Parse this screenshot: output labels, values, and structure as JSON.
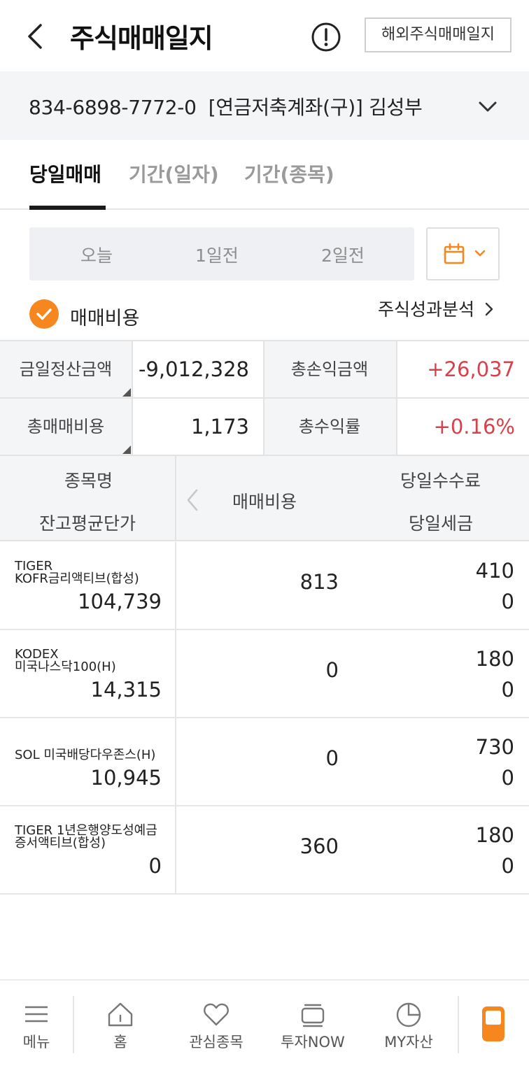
{
  "header": {
    "title": "주식매매일지",
    "foreign_button": "해외주식매매일지"
  },
  "account": {
    "text": "834-6898-7772-0  [연금저축계좌(구)] 김성부"
  },
  "tabs": [
    {
      "label": "당일매매",
      "active": true
    },
    {
      "label": "기간(일자)",
      "active": false
    },
    {
      "label": "기간(종목)",
      "active": false
    }
  ],
  "days": [
    "오늘",
    "1일전",
    "2일전"
  ],
  "options": {
    "fee_checkbox_label": "매매비용",
    "fee_checked": true,
    "analysis_link": "주식성과분석"
  },
  "summary": {
    "settle_label": "금일정산금액",
    "settle_value": "-9,012,328",
    "total_pl_label": "총손익금액",
    "total_pl_value": "+26,037",
    "total_cost_label": "총매매비용",
    "total_cost_value": "1,173",
    "return_label": "총수익률",
    "return_value": "+0.16%"
  },
  "table": {
    "headers": {
      "name": "종목명",
      "avg_price": "잔고평균단가",
      "cost": "매매비용",
      "fee": "당일수수료",
      "tax": "당일세금"
    },
    "rows": [
      {
        "name": "TIGER\nKOFR금리액티브(합성)",
        "avg_price": "104,739",
        "cost": "813",
        "fee": "410",
        "tax": "0"
      },
      {
        "name": "KODEX\n미국나스닥100(H)",
        "avg_price": "14,315",
        "cost": "0",
        "fee": "180",
        "tax": "0"
      },
      {
        "name": "SOL 미국배당다우존스(H)",
        "avg_price": "10,945",
        "cost": "0",
        "fee": "730",
        "tax": "0"
      },
      {
        "name": "TIGER 1년은행양도성예금\n증서액티브(합성)",
        "avg_price": "0",
        "cost": "360",
        "fee": "180",
        "tax": "0"
      }
    ]
  },
  "bottom_nav": [
    {
      "label": "메뉴",
      "icon": "menu-icon"
    },
    {
      "label": "홈",
      "icon": "home-icon"
    },
    {
      "label": "관심종목",
      "icon": "heart-icon"
    },
    {
      "label": "투자NOW",
      "icon": "stack-icon"
    },
    {
      "label": "MY자산",
      "icon": "pie-chart-icon"
    },
    {
      "label": "",
      "icon": "phone-icon"
    }
  ],
  "colors": {
    "accent": "#f6871f",
    "positive": "#d8414b"
  }
}
